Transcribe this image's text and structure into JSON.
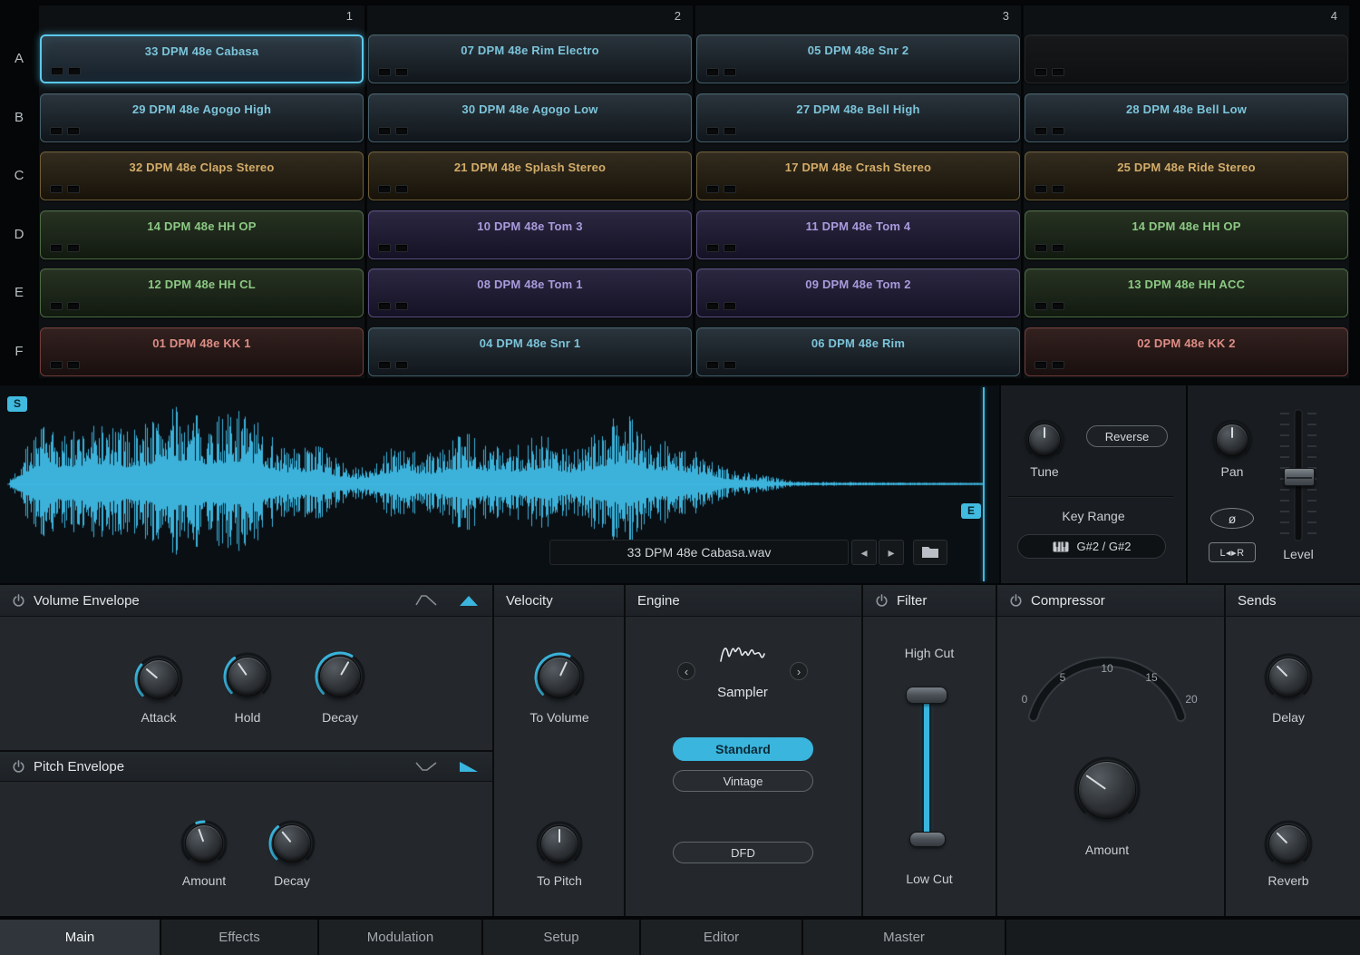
{
  "colors": {
    "accent": "#3ab5dd",
    "waveform": "#3fbce6"
  },
  "pad_grid": {
    "column_numbers": [
      "1",
      "2",
      "3",
      "4"
    ],
    "rows": [
      {
        "letter": "A",
        "cells": [
          {
            "label": "33 DPM 48e Cabasa",
            "color": "blue",
            "selected": true
          },
          {
            "label": "07 DPM 48e Rim Electro",
            "color": "blue"
          },
          {
            "label": "05 DPM 48e Snr 2",
            "color": "blue"
          },
          {
            "label": "",
            "color": "empty"
          }
        ]
      },
      {
        "letter": "B",
        "cells": [
          {
            "label": "29 DPM 48e Agogo High",
            "color": "blue"
          },
          {
            "label": "30 DPM 48e Agogo Low",
            "color": "blue"
          },
          {
            "label": "27 DPM 48e Bell High",
            "color": "blue"
          },
          {
            "label": "28 DPM 48e Bell Low",
            "color": "blue"
          }
        ]
      },
      {
        "letter": "C",
        "cells": [
          {
            "label": "32 DPM 48e Claps Stereo",
            "color": "orange"
          },
          {
            "label": "21 DPM 48e Splash Stereo",
            "color": "orange"
          },
          {
            "label": "17 DPM 48e Crash Stereo",
            "color": "orange"
          },
          {
            "label": "25 DPM 48e Ride Stereo",
            "color": "orange"
          }
        ]
      },
      {
        "letter": "D",
        "cells": [
          {
            "label": "14 DPM 48e HH OP",
            "color": "green"
          },
          {
            "label": "10 DPM 48e Tom 3",
            "color": "purple"
          },
          {
            "label": "11 DPM 48e Tom 4",
            "color": "purple"
          },
          {
            "label": "14 DPM 48e HH OP",
            "color": "green"
          }
        ]
      },
      {
        "letter": "E",
        "cells": [
          {
            "label": "12 DPM 48e HH CL",
            "color": "green"
          },
          {
            "label": "08 DPM 48e Tom 1",
            "color": "purple"
          },
          {
            "label": "09 DPM 48e Tom 2",
            "color": "purple"
          },
          {
            "label": "13 DPM 48e HH ACC",
            "color": "green"
          }
        ]
      },
      {
        "letter": "F",
        "cells": [
          {
            "label": "01 DPM 48e KK 1",
            "color": "red"
          },
          {
            "label": "04 DPM 48e Snr 1",
            "color": "blue"
          },
          {
            "label": "06 DPM 48e Rim",
            "color": "blue"
          },
          {
            "label": "02 DPM 48e KK 2",
            "color": "red"
          }
        ]
      }
    ]
  },
  "wave_panel": {
    "start_marker": "S",
    "end_marker": "E",
    "file": {
      "name": "33 DPM 48e Cabasa.wav",
      "prev": "◂",
      "next": "▸"
    },
    "tune": {
      "label": "Tune",
      "reverse": "Reverse"
    },
    "key_range": {
      "label": "Key Range",
      "value": "G#2  /  G#2"
    },
    "pan": {
      "label": "Pan",
      "phase": "ø",
      "lr": "L◂▸R",
      "level": "Level"
    }
  },
  "sections": {
    "volume_envelope": {
      "title": "Volume Envelope",
      "knobs": [
        "Attack",
        "Hold",
        "Decay"
      ]
    },
    "pitch_envelope": {
      "title": "Pitch Envelope",
      "knobs": [
        "Amount",
        "Decay"
      ]
    },
    "velocity": {
      "title": "Velocity",
      "knobs": [
        "To Volume",
        "To Pitch"
      ]
    },
    "engine": {
      "title": "Engine",
      "mode": "Sampler",
      "prev": "‹",
      "next": "›",
      "buttons": [
        "Standard",
        "Vintage",
        "DFD"
      ],
      "active_button": "Standard"
    },
    "filter": {
      "title": "Filter",
      "high": "High Cut",
      "low": "Low Cut"
    },
    "compressor": {
      "title": "Compressor",
      "scale": [
        "0",
        "5",
        "10",
        "15",
        "20"
      ],
      "knob": "Amount"
    },
    "sends": {
      "title": "Sends",
      "knobs": [
        "Delay",
        "Reverb"
      ]
    }
  },
  "tabs": {
    "items": [
      "Main",
      "Effects",
      "Modulation",
      "Setup",
      "Editor",
      "Master"
    ],
    "active": "Main"
  }
}
